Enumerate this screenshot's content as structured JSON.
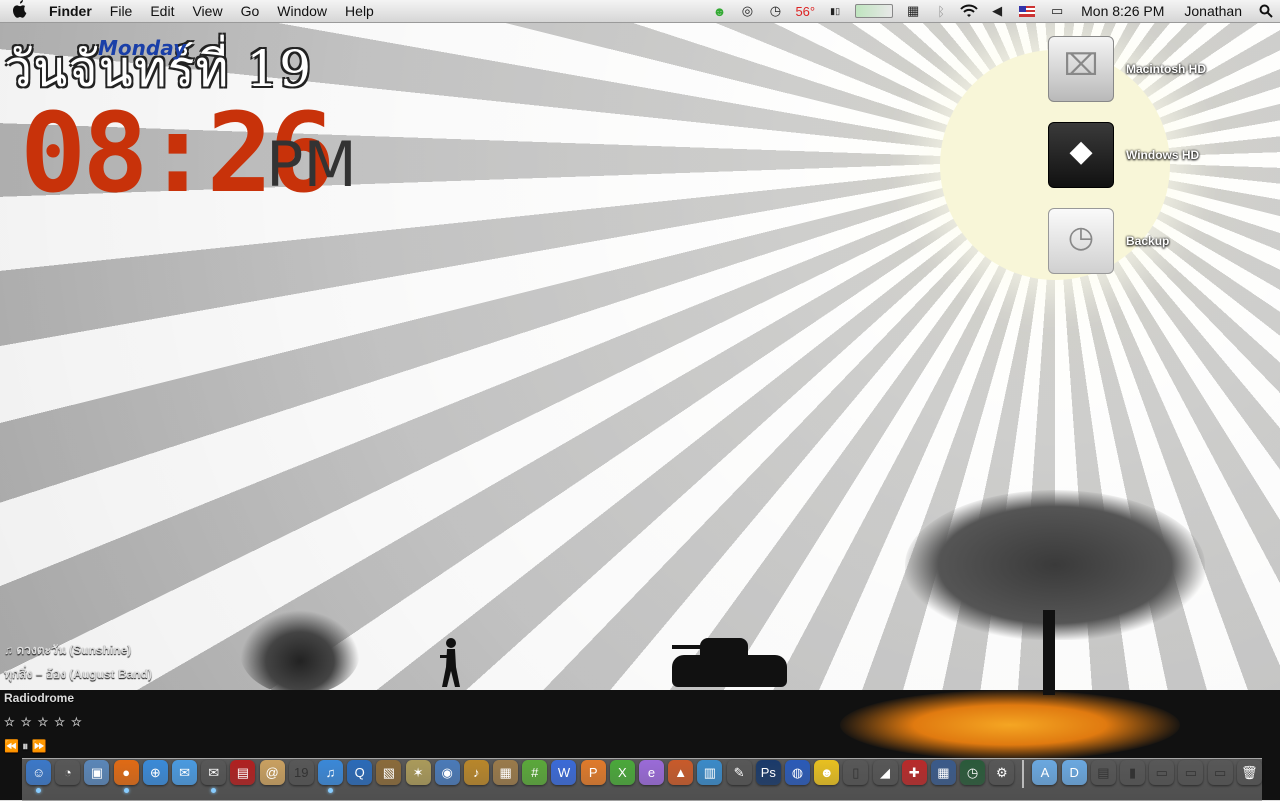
{
  "menubar": {
    "apple_icon": "apple-icon",
    "app_name": "Finder",
    "menus": [
      "File",
      "Edit",
      "View",
      "Go",
      "Window",
      "Help"
    ],
    "temperature": "56°",
    "clock": "Mon 8:26 PM",
    "user": "Jonathan"
  },
  "widget": {
    "thai_day": "วันจันทร์ที่ 19",
    "english_day": "Monday",
    "time": "08:26",
    "ampm": "PM"
  },
  "desktop_icons": [
    {
      "label": "Macintosh HD",
      "icon": "hard-drive-icon"
    },
    {
      "label": "Windows HD",
      "icon": "windows-drive-icon"
    },
    {
      "label": "Backup",
      "icon": "time-machine-drive-icon"
    }
  ],
  "music": {
    "song": "♫ ดวงตะวัน (Sunshine)",
    "artist": "ทุกสิ่ง – อ้อง (August Band)",
    "station": "Radiodrome",
    "rating_stars": "☆☆☆☆☆",
    "controls": "⏪ ⏸ ⏩"
  },
  "dock": {
    "apps": [
      {
        "name": "finder",
        "glyph": "☺",
        "color": "#3b78c8",
        "running": true
      },
      {
        "name": "dashboard",
        "glyph": "◔",
        "color": "#444",
        "running": false
      },
      {
        "name": "preview",
        "glyph": "▣",
        "color": "#5a86b8",
        "running": false
      },
      {
        "name": "firefox",
        "glyph": "●",
        "color": "#e06a14",
        "running": true
      },
      {
        "name": "safari",
        "glyph": "⊕",
        "color": "#3a8ad8",
        "running": false
      },
      {
        "name": "ichat",
        "glyph": "✉",
        "color": "#4a9ae0",
        "running": false
      },
      {
        "name": "mail",
        "glyph": "✉",
        "color": "#888",
        "running": true
      },
      {
        "name": "address-book",
        "glyph": "▤",
        "color": "#b02020",
        "running": false
      },
      {
        "name": "stickies",
        "glyph": "@",
        "color": "#c9a060",
        "running": false
      },
      {
        "name": "ical",
        "glyph": "19",
        "color": "#eee",
        "running": false
      },
      {
        "name": "itunes",
        "glyph": "♫",
        "color": "#3a88d8",
        "running": true
      },
      {
        "name": "quicktime",
        "glyph": "Q",
        "color": "#2a6ab8",
        "running": false
      },
      {
        "name": "iphoto",
        "glyph": "▧",
        "color": "#8a6a3a",
        "running": false
      },
      {
        "name": "utility",
        "glyph": "✶",
        "color": "#aa9a5a",
        "running": false
      },
      {
        "name": "disk-utility",
        "glyph": "◉",
        "color": "#4a7ab8",
        "running": false
      },
      {
        "name": "garageband",
        "glyph": "♪",
        "color": "#b8862a",
        "running": false
      },
      {
        "name": "imovie",
        "glyph": "▦",
        "color": "#9a7a4a",
        "running": false
      },
      {
        "name": "numbers",
        "glyph": "#",
        "color": "#5aa83a",
        "running": false
      },
      {
        "name": "ms-word",
        "glyph": "W",
        "color": "#3a6ad8",
        "running": false
      },
      {
        "name": "ms-powerpoint",
        "glyph": "P",
        "color": "#e07a2a",
        "running": false
      },
      {
        "name": "ms-excel",
        "glyph": "X",
        "color": "#4aa83a",
        "running": false
      },
      {
        "name": "ms-entourage",
        "glyph": "e",
        "color": "#9a6ad8",
        "running": false
      },
      {
        "name": "keynote",
        "glyph": "▲",
        "color": "#c85a2a",
        "running": false
      },
      {
        "name": "charts",
        "glyph": "▥",
        "color": "#3a8ac8",
        "running": false
      },
      {
        "name": "script-editor",
        "glyph": "✎",
        "color": "#666",
        "running": false
      },
      {
        "name": "photoshop",
        "glyph": "Ps",
        "color": "#1a3a6a",
        "running": false
      },
      {
        "name": "google-earth",
        "glyph": "◍",
        "color": "#2a5ab8",
        "running": false
      },
      {
        "name": "messenger",
        "glyph": "☻",
        "color": "#e8c020",
        "running": false
      },
      {
        "name": "remote",
        "glyph": "▯",
        "color": "#ccc",
        "running": false
      },
      {
        "name": "boot-camp",
        "glyph": "◢",
        "color": "#555",
        "running": false
      },
      {
        "name": "ejector",
        "glyph": "✚",
        "color": "#b82a2a",
        "running": false
      },
      {
        "name": "spaces",
        "glyph": "▦",
        "color": "#3a5a8a",
        "running": false
      },
      {
        "name": "time-machine",
        "glyph": "◷",
        "color": "#2a5a3a",
        "running": false
      },
      {
        "name": "system-preferences",
        "glyph": "⚙",
        "color": "#777",
        "running": false
      }
    ],
    "stacks": [
      {
        "name": "applications-folder",
        "glyph": "A",
        "color": "#6aa8e0"
      },
      {
        "name": "documents-folder",
        "glyph": "D",
        "color": "#6aa8e0"
      },
      {
        "name": "document-stack",
        "glyph": "▤",
        "color": "#eee"
      },
      {
        "name": "downloads-stack",
        "glyph": "▮",
        "color": "#ddd"
      },
      {
        "name": "screenshot-stack-1",
        "glyph": "▭",
        "color": "#eee"
      },
      {
        "name": "screenshot-stack-2",
        "glyph": "▭",
        "color": "#ddd"
      },
      {
        "name": "screenshot-stack-3",
        "glyph": "▭",
        "color": "#ccc"
      },
      {
        "name": "trash",
        "glyph": "🗑",
        "color": "#999"
      }
    ]
  }
}
